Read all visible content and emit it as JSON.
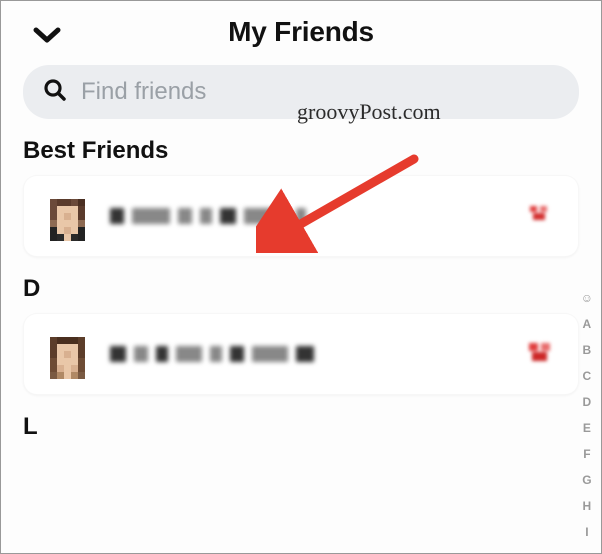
{
  "header": {
    "title": "My Friends"
  },
  "search": {
    "placeholder": "Find friends"
  },
  "sections": {
    "best_friends": {
      "label": "Best Friends"
    },
    "d": {
      "label": "D"
    },
    "l": {
      "label": "L"
    }
  },
  "friends": {
    "best": [
      {
        "name_obscured": true,
        "badge": "red-heart"
      }
    ],
    "d": [
      {
        "name_obscured": true,
        "badge": "red-heart"
      }
    ]
  },
  "index_bar": [
    "☺",
    "A",
    "B",
    "C",
    "D",
    "E",
    "F",
    "G",
    "H",
    "I"
  ],
  "watermark": "groovyPost.com"
}
